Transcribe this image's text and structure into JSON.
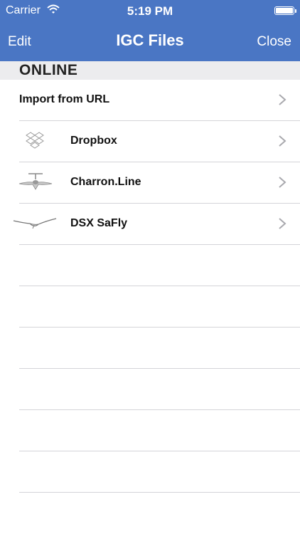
{
  "status_bar": {
    "carrier": "Carrier",
    "time": "5:19 PM"
  },
  "nav": {
    "edit": "Edit",
    "title": "IGC Files",
    "close": "Close"
  },
  "section": {
    "title": "ONLINE"
  },
  "items": [
    {
      "label": "Import from URL",
      "icon": "none"
    },
    {
      "label": "Dropbox",
      "icon": "dropbox-icon"
    },
    {
      "label": "Charron.Line",
      "icon": "glider-icon"
    },
    {
      "label": "DSX SaFly",
      "icon": "bird-icon"
    }
  ],
  "colors": {
    "nav_bg": "#4a76c4",
    "section_bg": "#ececee",
    "separator": "#d4d4d8",
    "chevron": "#a9a9ae"
  }
}
